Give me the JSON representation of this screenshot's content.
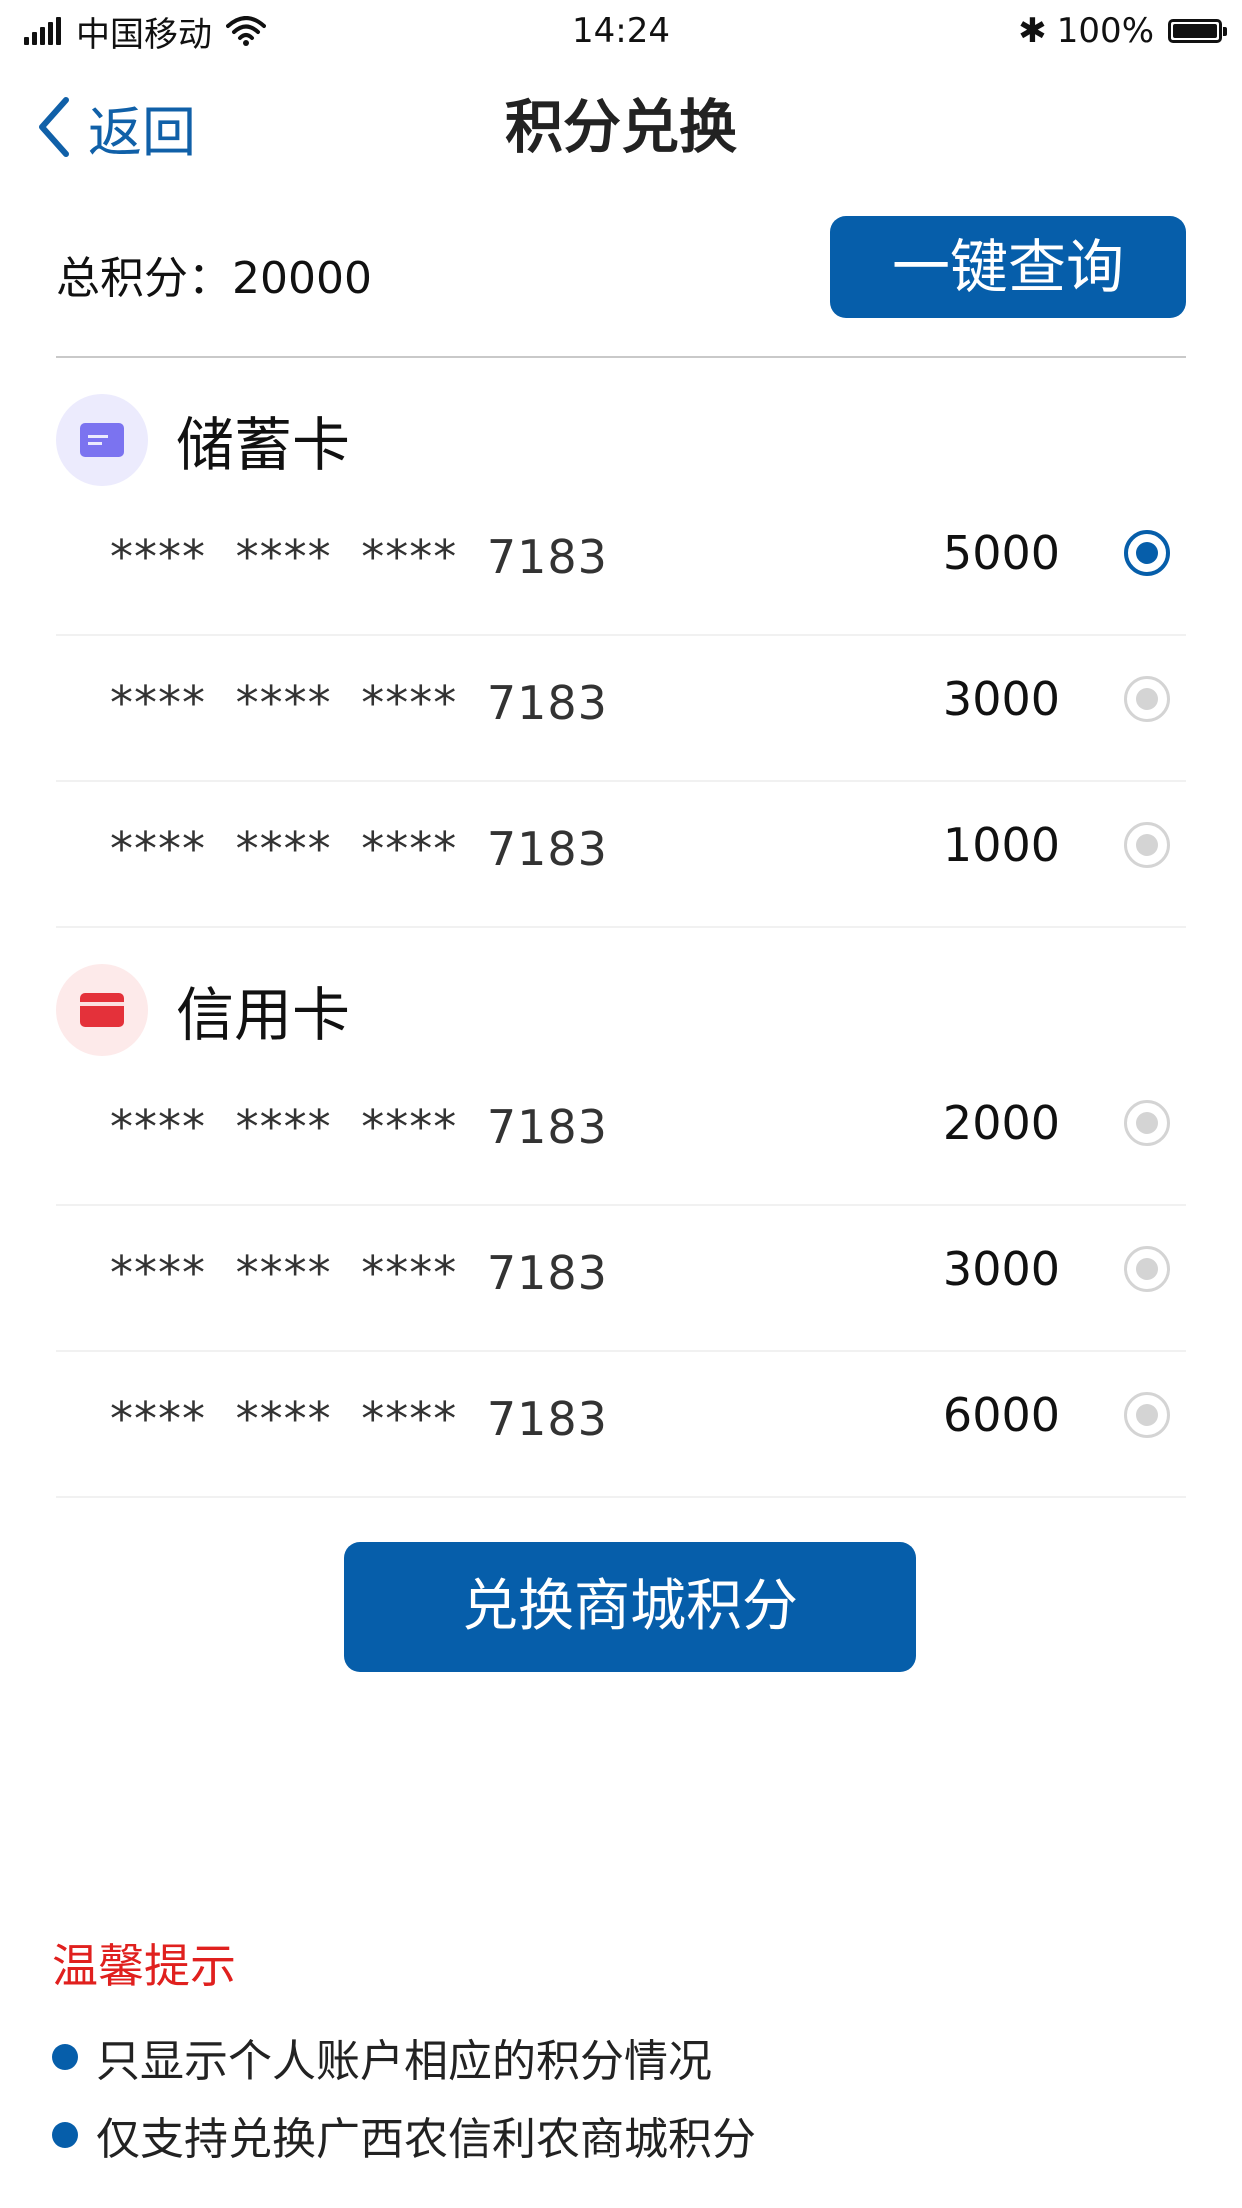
{
  "status_bar": {
    "carrier": "中国移动",
    "time": "14:24",
    "bluetooth": "✱",
    "battery_text": "100%",
    "icons": [
      "signal-icon",
      "wifi-icon",
      "bluetooth-icon",
      "battery-icon"
    ]
  },
  "nav": {
    "back_label": "返回",
    "title": "积分兑换"
  },
  "summary": {
    "total_label": "总积分：",
    "total_value": "20000",
    "query_button": "一键查询"
  },
  "debit": {
    "title": "储蓄卡",
    "icon": "debit-card-icon",
    "icon_color": "#7b73f0",
    "icon_bg": "#ecebfd",
    "cards": [
      {
        "number": "**** **** **** 7183",
        "points": "5000",
        "selected": true
      },
      {
        "number": "**** **** **** 7183",
        "points": "3000",
        "selected": false
      },
      {
        "number": "**** **** **** 7183",
        "points": "1000",
        "selected": false
      }
    ]
  },
  "credit": {
    "title": "信用卡",
    "icon": "credit-card-icon",
    "icon_color": "#e4313a",
    "icon_bg": "#fdeaea",
    "cards": [
      {
        "number": "**** **** **** 7183",
        "points": "2000",
        "selected": false
      },
      {
        "number": "**** **** **** 7183",
        "points": "3000",
        "selected": false
      },
      {
        "number": "**** **** **** 7183",
        "points": "6000",
        "selected": false
      }
    ]
  },
  "exchange_button": "兑换商城积分",
  "tips": {
    "title": "温馨提示",
    "items": [
      "只显示个人账户相应的积分情况",
      "仅支持兑换广西农信利农商城积分"
    ]
  },
  "colors": {
    "primary": "#065eaa",
    "tip_title": "#e0201e"
  }
}
